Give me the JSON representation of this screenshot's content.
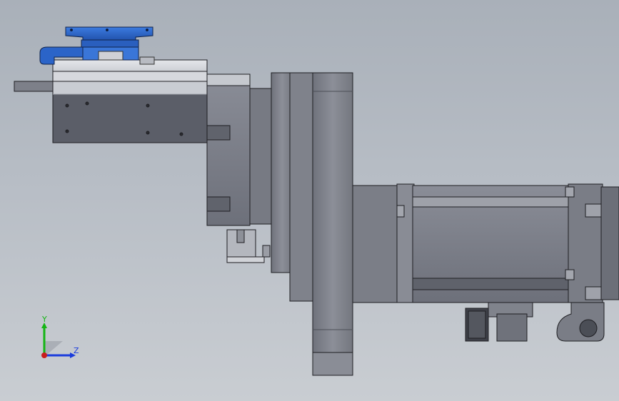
{
  "viewport": {
    "background_top": "#a9b0b9",
    "background_bottom": "#c9cdd2"
  },
  "model": {
    "part_color": "#7c7f89",
    "part_dark": "#555861",
    "edge_color": "#1e1e22",
    "highlight_color": "#d9dbe0",
    "accent_color": "#2a62c9"
  },
  "triad": {
    "y_label": "Y",
    "z_label": "Z",
    "y_color": "#15b515",
    "z_color": "#1a3cdc",
    "x_color": "#c81e1e"
  }
}
